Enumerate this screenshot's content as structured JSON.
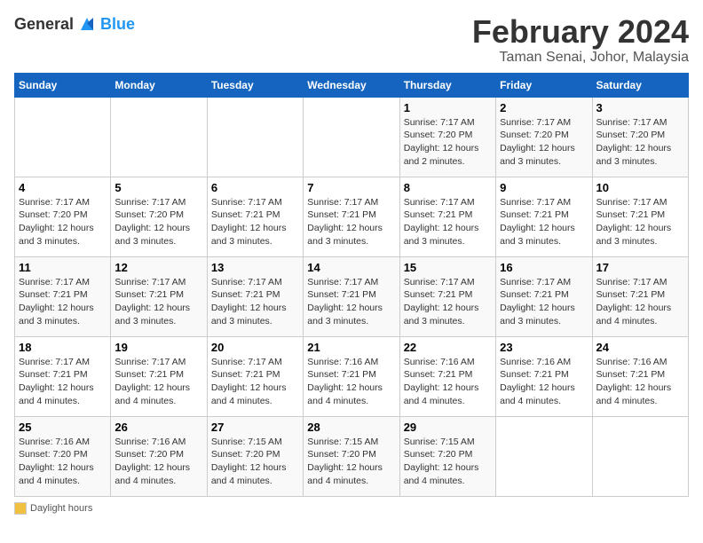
{
  "logo": {
    "text_general": "General",
    "text_blue": "Blue"
  },
  "header": {
    "month_year": "February 2024",
    "location": "Taman Senai, Johor, Malaysia"
  },
  "weekdays": [
    "Sunday",
    "Monday",
    "Tuesday",
    "Wednesday",
    "Thursday",
    "Friday",
    "Saturday"
  ],
  "weeks": [
    [
      {
        "day": "",
        "info": ""
      },
      {
        "day": "",
        "info": ""
      },
      {
        "day": "",
        "info": ""
      },
      {
        "day": "",
        "info": ""
      },
      {
        "day": "1",
        "sunrise": "7:17 AM",
        "sunset": "7:20 PM",
        "daylight": "12 hours and 2 minutes."
      },
      {
        "day": "2",
        "sunrise": "7:17 AM",
        "sunset": "7:20 PM",
        "daylight": "12 hours and 3 minutes."
      },
      {
        "day": "3",
        "sunrise": "7:17 AM",
        "sunset": "7:20 PM",
        "daylight": "12 hours and 3 minutes."
      }
    ],
    [
      {
        "day": "4",
        "sunrise": "7:17 AM",
        "sunset": "7:20 PM",
        "daylight": "12 hours and 3 minutes."
      },
      {
        "day": "5",
        "sunrise": "7:17 AM",
        "sunset": "7:20 PM",
        "daylight": "12 hours and 3 minutes."
      },
      {
        "day": "6",
        "sunrise": "7:17 AM",
        "sunset": "7:21 PM",
        "daylight": "12 hours and 3 minutes."
      },
      {
        "day": "7",
        "sunrise": "7:17 AM",
        "sunset": "7:21 PM",
        "daylight": "12 hours and 3 minutes."
      },
      {
        "day": "8",
        "sunrise": "7:17 AM",
        "sunset": "7:21 PM",
        "daylight": "12 hours and 3 minutes."
      },
      {
        "day": "9",
        "sunrise": "7:17 AM",
        "sunset": "7:21 PM",
        "daylight": "12 hours and 3 minutes."
      },
      {
        "day": "10",
        "sunrise": "7:17 AM",
        "sunset": "7:21 PM",
        "daylight": "12 hours and 3 minutes."
      }
    ],
    [
      {
        "day": "11",
        "sunrise": "7:17 AM",
        "sunset": "7:21 PM",
        "daylight": "12 hours and 3 minutes."
      },
      {
        "day": "12",
        "sunrise": "7:17 AM",
        "sunset": "7:21 PM",
        "daylight": "12 hours and 3 minutes."
      },
      {
        "day": "13",
        "sunrise": "7:17 AM",
        "sunset": "7:21 PM",
        "daylight": "12 hours and 3 minutes."
      },
      {
        "day": "14",
        "sunrise": "7:17 AM",
        "sunset": "7:21 PM",
        "daylight": "12 hours and 3 minutes."
      },
      {
        "day": "15",
        "sunrise": "7:17 AM",
        "sunset": "7:21 PM",
        "daylight": "12 hours and 3 minutes."
      },
      {
        "day": "16",
        "sunrise": "7:17 AM",
        "sunset": "7:21 PM",
        "daylight": "12 hours and 3 minutes."
      },
      {
        "day": "17",
        "sunrise": "7:17 AM",
        "sunset": "7:21 PM",
        "daylight": "12 hours and 4 minutes."
      }
    ],
    [
      {
        "day": "18",
        "sunrise": "7:17 AM",
        "sunset": "7:21 PM",
        "daylight": "12 hours and 4 minutes."
      },
      {
        "day": "19",
        "sunrise": "7:17 AM",
        "sunset": "7:21 PM",
        "daylight": "12 hours and 4 minutes."
      },
      {
        "day": "20",
        "sunrise": "7:17 AM",
        "sunset": "7:21 PM",
        "daylight": "12 hours and 4 minutes."
      },
      {
        "day": "21",
        "sunrise": "7:16 AM",
        "sunset": "7:21 PM",
        "daylight": "12 hours and 4 minutes."
      },
      {
        "day": "22",
        "sunrise": "7:16 AM",
        "sunset": "7:21 PM",
        "daylight": "12 hours and 4 minutes."
      },
      {
        "day": "23",
        "sunrise": "7:16 AM",
        "sunset": "7:21 PM",
        "daylight": "12 hours and 4 minutes."
      },
      {
        "day": "24",
        "sunrise": "7:16 AM",
        "sunset": "7:21 PM",
        "daylight": "12 hours and 4 minutes."
      }
    ],
    [
      {
        "day": "25",
        "sunrise": "7:16 AM",
        "sunset": "7:20 PM",
        "daylight": "12 hours and 4 minutes."
      },
      {
        "day": "26",
        "sunrise": "7:16 AM",
        "sunset": "7:20 PM",
        "daylight": "12 hours and 4 minutes."
      },
      {
        "day": "27",
        "sunrise": "7:15 AM",
        "sunset": "7:20 PM",
        "daylight": "12 hours and 4 minutes."
      },
      {
        "day": "28",
        "sunrise": "7:15 AM",
        "sunset": "7:20 PM",
        "daylight": "12 hours and 4 minutes."
      },
      {
        "day": "29",
        "sunrise": "7:15 AM",
        "sunset": "7:20 PM",
        "daylight": "12 hours and 4 minutes."
      },
      {
        "day": "",
        "info": ""
      },
      {
        "day": "",
        "info": ""
      }
    ]
  ],
  "footer": {
    "daylight_label": "Daylight hours"
  }
}
